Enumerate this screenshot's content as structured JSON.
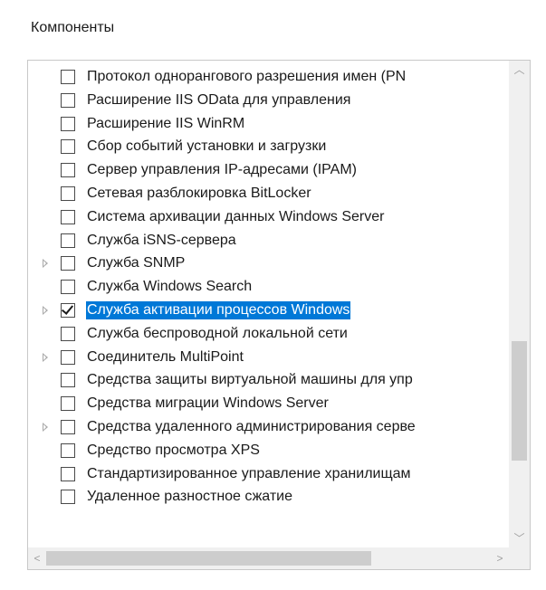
{
  "section": {
    "title": "Компоненты"
  },
  "items": [
    {
      "label": "Протокол однорангового разрешения имен (PN",
      "checked": false,
      "expandable": false,
      "selected": false
    },
    {
      "label": "Расширение IIS OData для управления",
      "checked": false,
      "expandable": false,
      "selected": false
    },
    {
      "label": "Расширение IIS WinRM",
      "checked": false,
      "expandable": false,
      "selected": false
    },
    {
      "label": "Сбор событий установки и загрузки",
      "checked": false,
      "expandable": false,
      "selected": false
    },
    {
      "label": "Сервер управления IP-адресами (IPAM)",
      "checked": false,
      "expandable": false,
      "selected": false
    },
    {
      "label": "Сетевая разблокировка BitLocker",
      "checked": false,
      "expandable": false,
      "selected": false
    },
    {
      "label": "Система архивации данных Windows Server",
      "checked": false,
      "expandable": false,
      "selected": false
    },
    {
      "label": "Служба iSNS-сервера",
      "checked": false,
      "expandable": false,
      "selected": false
    },
    {
      "label": "Служба SNMP",
      "checked": false,
      "expandable": true,
      "selected": false
    },
    {
      "label": "Служба Windows Search",
      "checked": false,
      "expandable": false,
      "selected": false
    },
    {
      "label": "Служба активации процессов Windows",
      "checked": true,
      "expandable": true,
      "selected": true
    },
    {
      "label": "Служба беспроводной локальной сети",
      "checked": false,
      "expandable": false,
      "selected": false
    },
    {
      "label": "Соединитель MultiPoint",
      "checked": false,
      "expandable": true,
      "selected": false
    },
    {
      "label": "Средства защиты виртуальной машины для упр",
      "checked": false,
      "expandable": false,
      "selected": false
    },
    {
      "label": "Средства миграции Windows Server",
      "checked": false,
      "expandable": false,
      "selected": false
    },
    {
      "label": "Средства удаленного администрирования серве",
      "checked": false,
      "expandable": true,
      "selected": false
    },
    {
      "label": "Средство просмотра XPS",
      "checked": false,
      "expandable": false,
      "selected": false
    },
    {
      "label": "Стандартизированное управление хранилищам",
      "checked": false,
      "expandable": false,
      "selected": false
    },
    {
      "label": "Удаленное разностное сжатие",
      "checked": false,
      "expandable": false,
      "selected": false
    }
  ],
  "scroll": {
    "vertical_position": 0.72,
    "horizontal_position": 0.0
  },
  "icons": {
    "expander": "chevron-right-icon",
    "scroll_up": "chevron-up-icon",
    "scroll_down": "chevron-down-icon",
    "scroll_left": "chevron-left-icon",
    "scroll_right": "chevron-right-icon"
  },
  "colors": {
    "selection": "#0078d7",
    "selection_text": "#ffffff",
    "text": "#1a1a1a",
    "scrollbar_track": "#f0f0f0",
    "scrollbar_thumb": "#cdcdcd"
  }
}
